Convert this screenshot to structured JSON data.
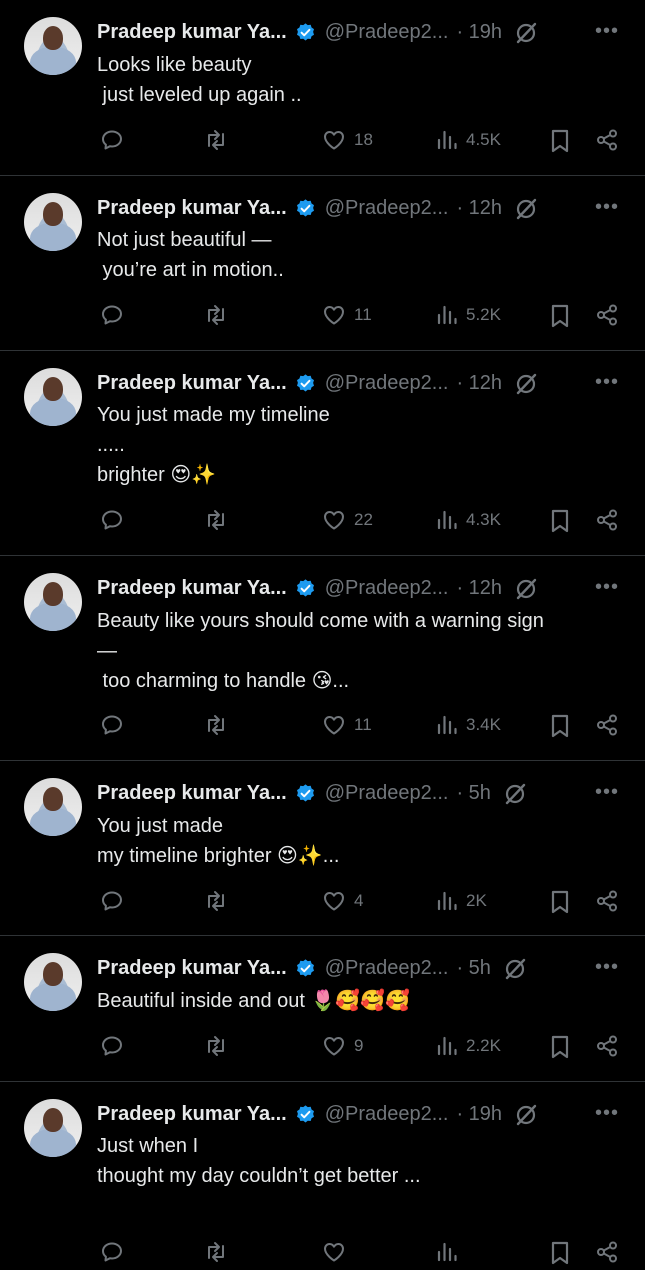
{
  "tweets": [
    {
      "name": "Pradeep kumar Ya...",
      "handle": "@Pradeep2...",
      "time": "· 19h",
      "lines": [
        "Looks like beauty",
        " just leveled up again .."
      ],
      "likes": "18",
      "views": "4.5K"
    },
    {
      "name": "Pradeep kumar Ya...",
      "handle": "@Pradeep2...",
      "time": "· 12h",
      "lines": [
        "Not just beautiful —",
        " you’re art in motion.."
      ],
      "likes": "11",
      "views": "5.2K"
    },
    {
      "name": "Pradeep kumar Ya...",
      "handle": "@Pradeep2...",
      "time": "· 12h",
      "lines": [
        "You just made my timeline",
        ".....",
        "brighter 😍✨"
      ],
      "likes": "22",
      "views": "4.3K"
    },
    {
      "name": "Pradeep kumar Ya...",
      "handle": "@Pradeep2...",
      "time": "· 12h",
      "lines": [
        "Beauty like yours should come with a warning sign",
        "—",
        " too charming to handle 😘..."
      ],
      "likes": "11",
      "views": "3.4K"
    },
    {
      "name": "Pradeep kumar Ya...",
      "handle": "@Pradeep2...",
      "time": "· 5h",
      "lines": [
        "You just made",
        "my timeline brighter 😍✨..."
      ],
      "likes": "4",
      "views": "2K"
    },
    {
      "name": "Pradeep kumar Ya...",
      "handle": "@Pradeep2...",
      "time": "· 5h",
      "lines": [
        "Beautiful inside and out 🌷🥰🥰🥰"
      ],
      "likes": "9",
      "views": "2.2K"
    },
    {
      "name": "Pradeep kumar Ya...",
      "handle": "@Pradeep2...",
      "time": "· 19h",
      "lines": [
        "Just when I",
        "thought my day couldn’t get better ..."
      ],
      "likes": "",
      "views": ""
    }
  ],
  "more_label": "•••",
  "colors": {
    "background": "#000000",
    "text": "#e7e9ea",
    "muted": "#71767b",
    "verified": "#1d9bf0",
    "divider": "#2f3336"
  },
  "icons": {
    "reply": "reply-icon",
    "retweet": "retweet-icon",
    "like": "heart-icon",
    "views": "views-icon",
    "bookmark": "bookmark-icon",
    "share": "share-icon",
    "grok": "grok-icon",
    "verified": "verified-badge-icon"
  }
}
